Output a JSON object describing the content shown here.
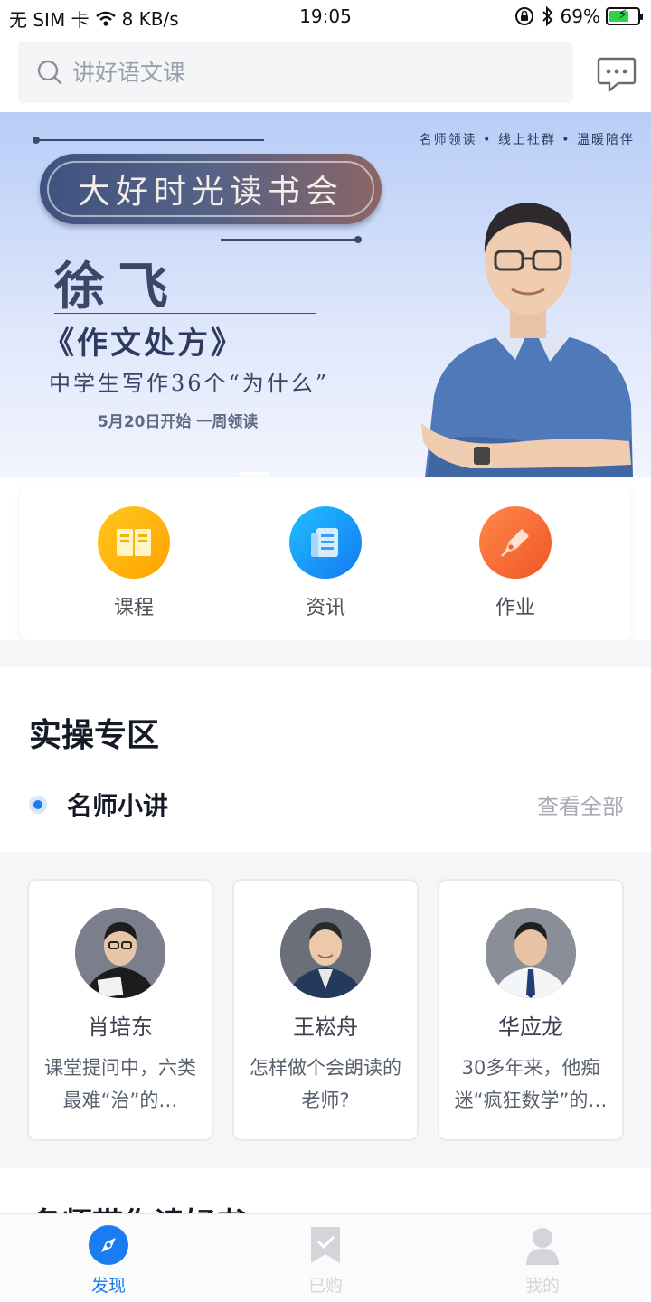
{
  "status_bar": {
    "carrier": "无 SIM 卡",
    "speed": "8 KB/s",
    "time": "19:05",
    "battery": "69%",
    "battery_level": 0.69,
    "icons": [
      "wifi-icon",
      "orientation-lock-icon",
      "bluetooth-icon",
      "battery-icon"
    ]
  },
  "search": {
    "placeholder": "讲好语文课",
    "icon": "search-icon"
  },
  "header": {
    "message_icon": "chat-bubble-icon"
  },
  "banner": {
    "tagline": "名师领读 • 线上社群 • 温暖陪伴",
    "title": "大好时光读书会",
    "author": "徐飞",
    "book": "《作文处方》",
    "subtitle": "中学生写作36个“为什么”",
    "date_text": "5月20日开始 一周领读"
  },
  "quick_entries": [
    {
      "label": "课程",
      "icon": "book-icon",
      "color": "#ffb400"
    },
    {
      "label": "资讯",
      "icon": "news-icon",
      "color": "#1a9cf5"
    },
    {
      "label": "作业",
      "icon": "pen-icon",
      "color": "#ff6b3a"
    }
  ],
  "section": {
    "title": "实操专区",
    "subsection": "名师小讲",
    "view_all": "查看全部"
  },
  "teachers": [
    {
      "name": "肖培东",
      "desc": "课堂提问中，六类最难“治”的…"
    },
    {
      "name": "王崧舟",
      "desc": "怎样做个会朗读的老师?"
    },
    {
      "name": "华应龙",
      "desc": "30多年来，他痴迷“疯狂数学”的…"
    }
  ],
  "next_section_title": "名师带你读好书",
  "tabs": [
    {
      "label": "发现",
      "icon": "compass-icon",
      "active": true
    },
    {
      "label": "已购",
      "icon": "bookmark-icon",
      "active": false
    },
    {
      "label": "我的",
      "icon": "user-icon",
      "active": false
    }
  ],
  "colors": {
    "accent": "#1a7cf0",
    "inactive_tab": "#d3d5da"
  }
}
